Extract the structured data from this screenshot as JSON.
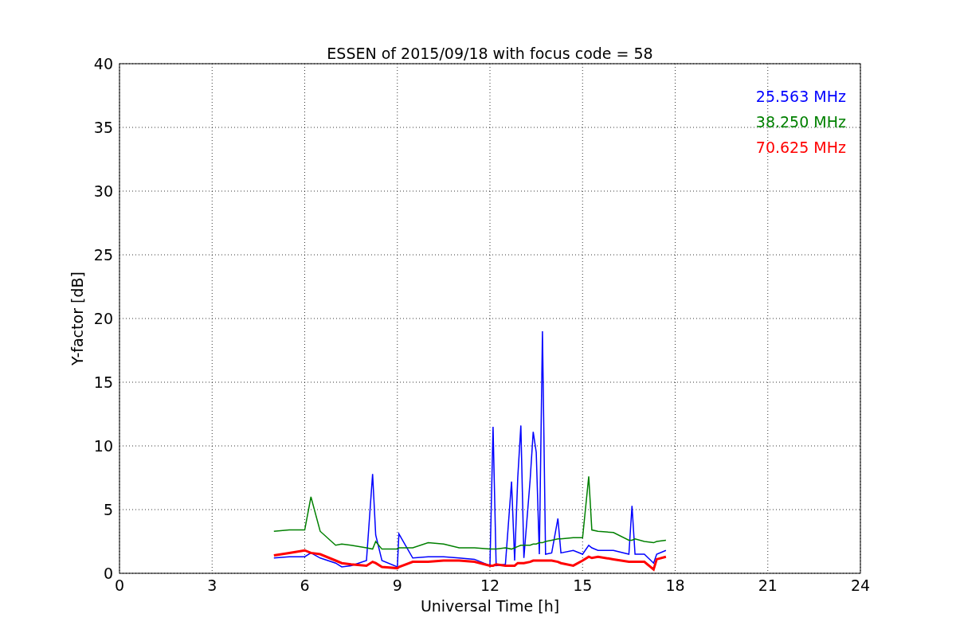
{
  "chart_data": {
    "type": "line",
    "title": "ESSEN of 2015/09/18 with focus code = 58",
    "xlabel": "Universal Time [h]",
    "ylabel": "Y-factor [dB]",
    "x": [
      5,
      5.5,
      6,
      6.2,
      6.5,
      7,
      7.2,
      7.5,
      8,
      8.2,
      8.3,
      8.5,
      9,
      9.05,
      9.5,
      10,
      10.5,
      11,
      11.5,
      12,
      12.1,
      12.2,
      12.5,
      12.7,
      12.8,
      12.9,
      13.0,
      13.1,
      13.3,
      13.4,
      13.5,
      13.6,
      13.7,
      13.8,
      14,
      14.2,
      14.3,
      14.7,
      15,
      15.2,
      15.3,
      15.5,
      16,
      16.5,
      16.6,
      16.7,
      17,
      17.3,
      17.4,
      17.7
    ],
    "series": [
      {
        "name": "25.563 MHz",
        "color": "#0000ff",
        "values": [
          1.2,
          1.3,
          1.3,
          1.6,
          1.2,
          0.8,
          0.5,
          0.6,
          1.0,
          7.8,
          3.0,
          1.0,
          0.5,
          3.1,
          1.2,
          1.3,
          1.3,
          1.2,
          1.1,
          0.6,
          11.5,
          0.6,
          0.7,
          7.2,
          1.0,
          7.5,
          11.6,
          1.2,
          7.3,
          11.1,
          9.5,
          1.5,
          19.0,
          1.5,
          1.6,
          4.3,
          1.6,
          1.8,
          1.5,
          2.2,
          2.0,
          1.8,
          1.8,
          1.5,
          5.3,
          1.5,
          1.5,
          0.8,
          1.5,
          1.8
        ]
      },
      {
        "name": "38.250 MHz",
        "color": "#008000",
        "values": [
          3.3,
          3.4,
          3.4,
          6.0,
          3.3,
          2.2,
          2.3,
          2.2,
          2.0,
          1.9,
          2.5,
          1.9,
          1.9,
          2.0,
          2.0,
          2.4,
          2.3,
          2.0,
          2.0,
          1.9,
          1.9,
          1.9,
          2.0,
          1.9,
          2.0,
          2.1,
          2.2,
          2.2,
          2.2,
          2.3,
          2.3,
          2.4,
          2.4,
          2.5,
          2.6,
          2.7,
          2.7,
          2.8,
          2.8,
          7.6,
          3.4,
          3.3,
          3.2,
          2.6,
          2.6,
          2.7,
          2.5,
          2.4,
          2.5,
          2.6
        ]
      },
      {
        "name": "70.625 MHz",
        "color": "#ff0000",
        "values": [
          1.4,
          1.6,
          1.8,
          1.6,
          1.5,
          1.0,
          0.8,
          0.7,
          0.6,
          0.9,
          0.8,
          0.5,
          0.4,
          0.5,
          0.9,
          0.9,
          1.0,
          1.0,
          0.9,
          0.6,
          0.6,
          0.7,
          0.6,
          0.6,
          0.6,
          0.8,
          0.8,
          0.8,
          0.9,
          1.0,
          1.0,
          1.0,
          1.0,
          1.0,
          1.0,
          0.9,
          0.8,
          0.6,
          1.0,
          1.3,
          1.2,
          1.3,
          1.1,
          0.9,
          0.9,
          0.9,
          0.9,
          0.3,
          1.1,
          1.3
        ]
      }
    ],
    "grid": true,
    "xlim": [
      0,
      24
    ],
    "ylim": [
      0,
      40
    ],
    "xticks": [
      0,
      3,
      6,
      9,
      12,
      15,
      18,
      21,
      24
    ],
    "yticks": [
      0,
      5,
      10,
      15,
      20,
      25,
      30,
      35,
      40
    ]
  }
}
